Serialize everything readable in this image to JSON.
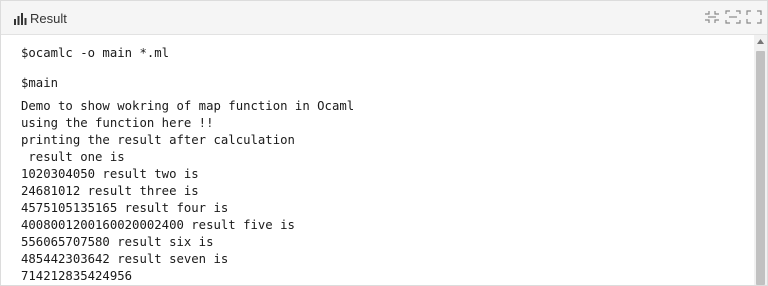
{
  "panel": {
    "title": "Result",
    "icons": [
      "bar-chart-icon",
      "collapse-icon",
      "expand-icon",
      "fullscreen-icon"
    ]
  },
  "terminal": {
    "compile_command": "$ocamlc -o main *.ml",
    "run_command": "$main",
    "output_lines": [
      "Demo to show wokring of map function in Ocaml",
      "using the function here !!",
      "printing the result after calculation",
      " result one is",
      "1020304050 result two is",
      "24681012 result three is",
      "4575105135165 result four is",
      "4008001200160020002400 result five is",
      "556065707580 result six is",
      "485442303642 result seven is",
      "714212835424956"
    ]
  },
  "colors": {
    "header_bg": "#f5f5f5",
    "text": "#1a1a1a",
    "scrollbar_thumb": "#c1c1c1"
  }
}
